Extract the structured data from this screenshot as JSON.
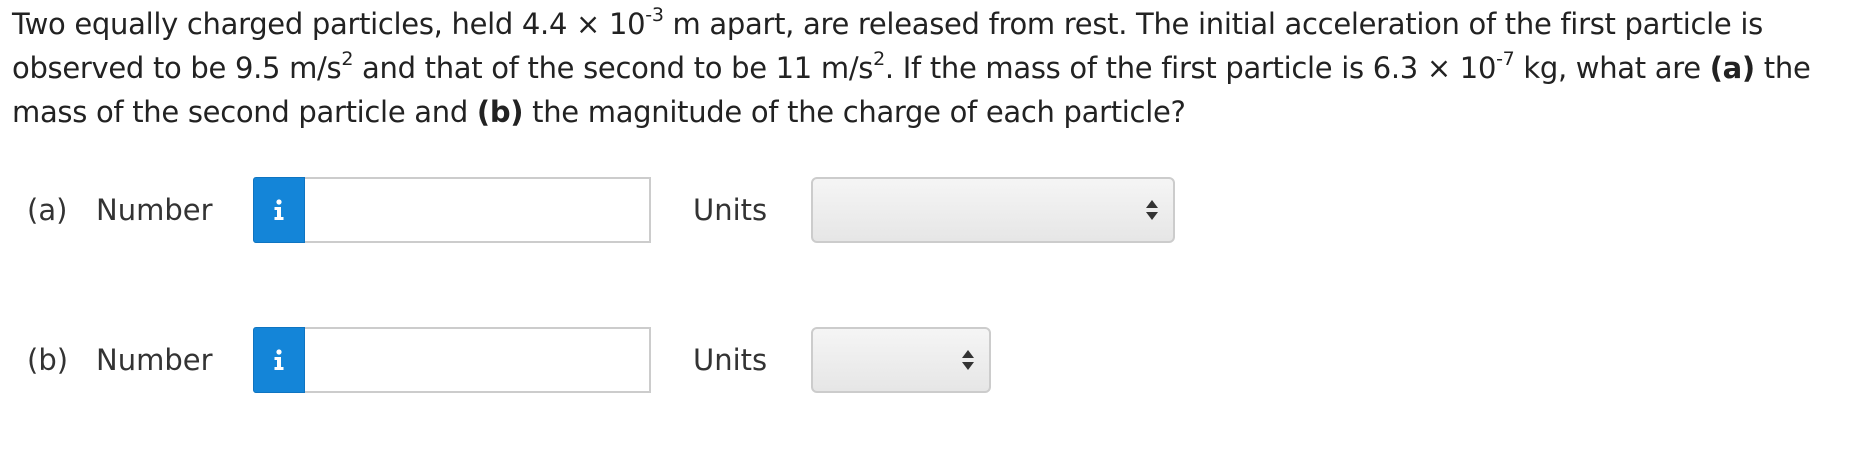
{
  "problem": {
    "intro": "Two equally charged particles, held 4.4 × 10",
    "exp_distance": "-3",
    "after_distance": " m apart, are released from rest. The initial acceleration of the first particle is observed to be 9.5 m/s",
    "exp_accel1": "2",
    "after_accel1": " and that of the second to be 11 m/s",
    "exp_accel2": "2",
    "after_accel2": ". If the mass of the first particle is 6.3 × 10",
    "exp_mass": "-7",
    "after_mass": " kg, what are ",
    "part_a_marker": "(a)",
    "part_a_text": " the mass of the second particle and ",
    "part_b_marker": "(b)",
    "part_b_text": " the magnitude of the charge of each particle?"
  },
  "answers": [
    {
      "label": "(a)",
      "number_label": "Number",
      "number_value": "",
      "units_label": "Units",
      "units_selected": ""
    },
    {
      "label": "(b)",
      "number_label": "Number",
      "number_value": "",
      "units_label": "Units",
      "units_selected": ""
    }
  ],
  "icons": {
    "info_button": "info-icon",
    "select_arrows": "sort-arrows-icon"
  },
  "colors": {
    "info_button_bg": "#1485d8",
    "input_border": "#cccccc",
    "text": "#222222"
  }
}
